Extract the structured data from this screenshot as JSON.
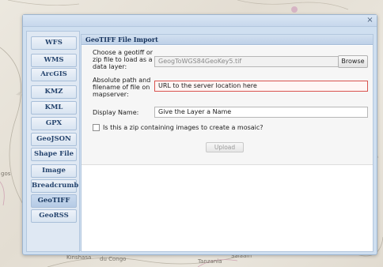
{
  "map": {
    "labels": [
      "gos",
      "Kinshasa",
      "du Congo",
      "Tanzania",
      "Salaam"
    ]
  },
  "dialog": {
    "close_glyph": "×",
    "tabs": [
      {
        "label": "WFS",
        "active": false
      },
      {
        "label": "WMS",
        "active": false
      },
      {
        "label": "ArcGIS",
        "active": false
      },
      {
        "label": "KMZ",
        "active": false
      },
      {
        "label": "KML",
        "active": false
      },
      {
        "label": "GPX",
        "active": false
      },
      {
        "label": "GeoJSON",
        "active": false
      },
      {
        "label": "Shape File",
        "active": false
      },
      {
        "label": "Image",
        "active": false
      },
      {
        "label": "Breadcrumb",
        "active": false
      },
      {
        "label": "GeoTIFF",
        "active": true
      },
      {
        "label": "GeoRSS",
        "active": false
      }
    ],
    "panel": {
      "title": "GeoTIFF File Import",
      "file_label": "Choose a geotiff or zip file to load as a data layer:",
      "file_value": "GeogToWGS84GeoKey5.tif",
      "browse_label": "Browse",
      "path_label": "Absolute path and filename of file on mapserver:",
      "path_placeholder": "URL to the server location here",
      "display_label": "Display Name:",
      "display_placeholder": "Give the Layer a Name",
      "mosaic_label": "Is this a zip containing images to create a mosaic?",
      "upload_label": "Upload"
    }
  },
  "colors": {
    "accent": "#25446e",
    "error_border": "#d9534f"
  }
}
